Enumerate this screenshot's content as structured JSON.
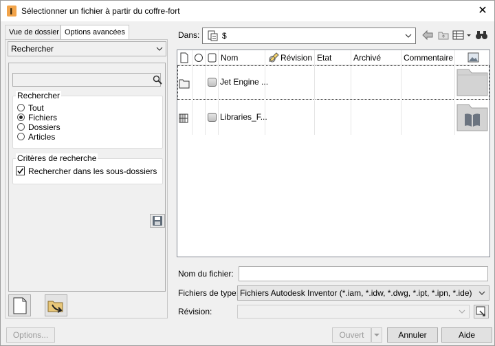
{
  "window": {
    "title": "Sélectionner un fichier à partir du coffre-fort",
    "close": "✕"
  },
  "tabs": [
    {
      "label": "Vue de dossier"
    },
    {
      "label": "Options avancées"
    }
  ],
  "left": {
    "mode_select": "Rechercher",
    "search": {
      "value": "",
      "placeholder": ""
    },
    "search_group": {
      "title": "Rechercher",
      "options": [
        "Tout",
        "Fichiers",
        "Dossiers",
        "Articles"
      ],
      "selected": "Fichiers"
    },
    "criteria_group": {
      "title": "Critères de recherche",
      "subfolders_label": "Rechercher dans les sous-dossiers",
      "subfolders_checked": true
    }
  },
  "location": {
    "label": "Dans:",
    "value": "$"
  },
  "grid": {
    "columns": [
      "Nom",
      "Révision",
      "Etat",
      "Archivé",
      "Commentaire"
    ],
    "rows": [
      {
        "name": "Jet Engine ...",
        "kind": "folder",
        "selected": true
      },
      {
        "name": "Libraries_F...",
        "kind": "library",
        "selected": false
      }
    ]
  },
  "form": {
    "filename_label": "Nom du fichier:",
    "filename_value": "",
    "filetype_label": "Fichiers de type:",
    "filetype_value": "Fichiers Autodesk Inventor (*.iam, *.idw, *.dwg, *.ipt, *.ipn, *.ide)",
    "revision_label": "Révision:",
    "revision_value": ""
  },
  "buttons": {
    "options": "Options...",
    "open": "Ouvert",
    "cancel": "Annuler",
    "help": "Aide"
  },
  "colors": {
    "app_icon": "#f2a44a",
    "folder": "#cfcfcf"
  }
}
